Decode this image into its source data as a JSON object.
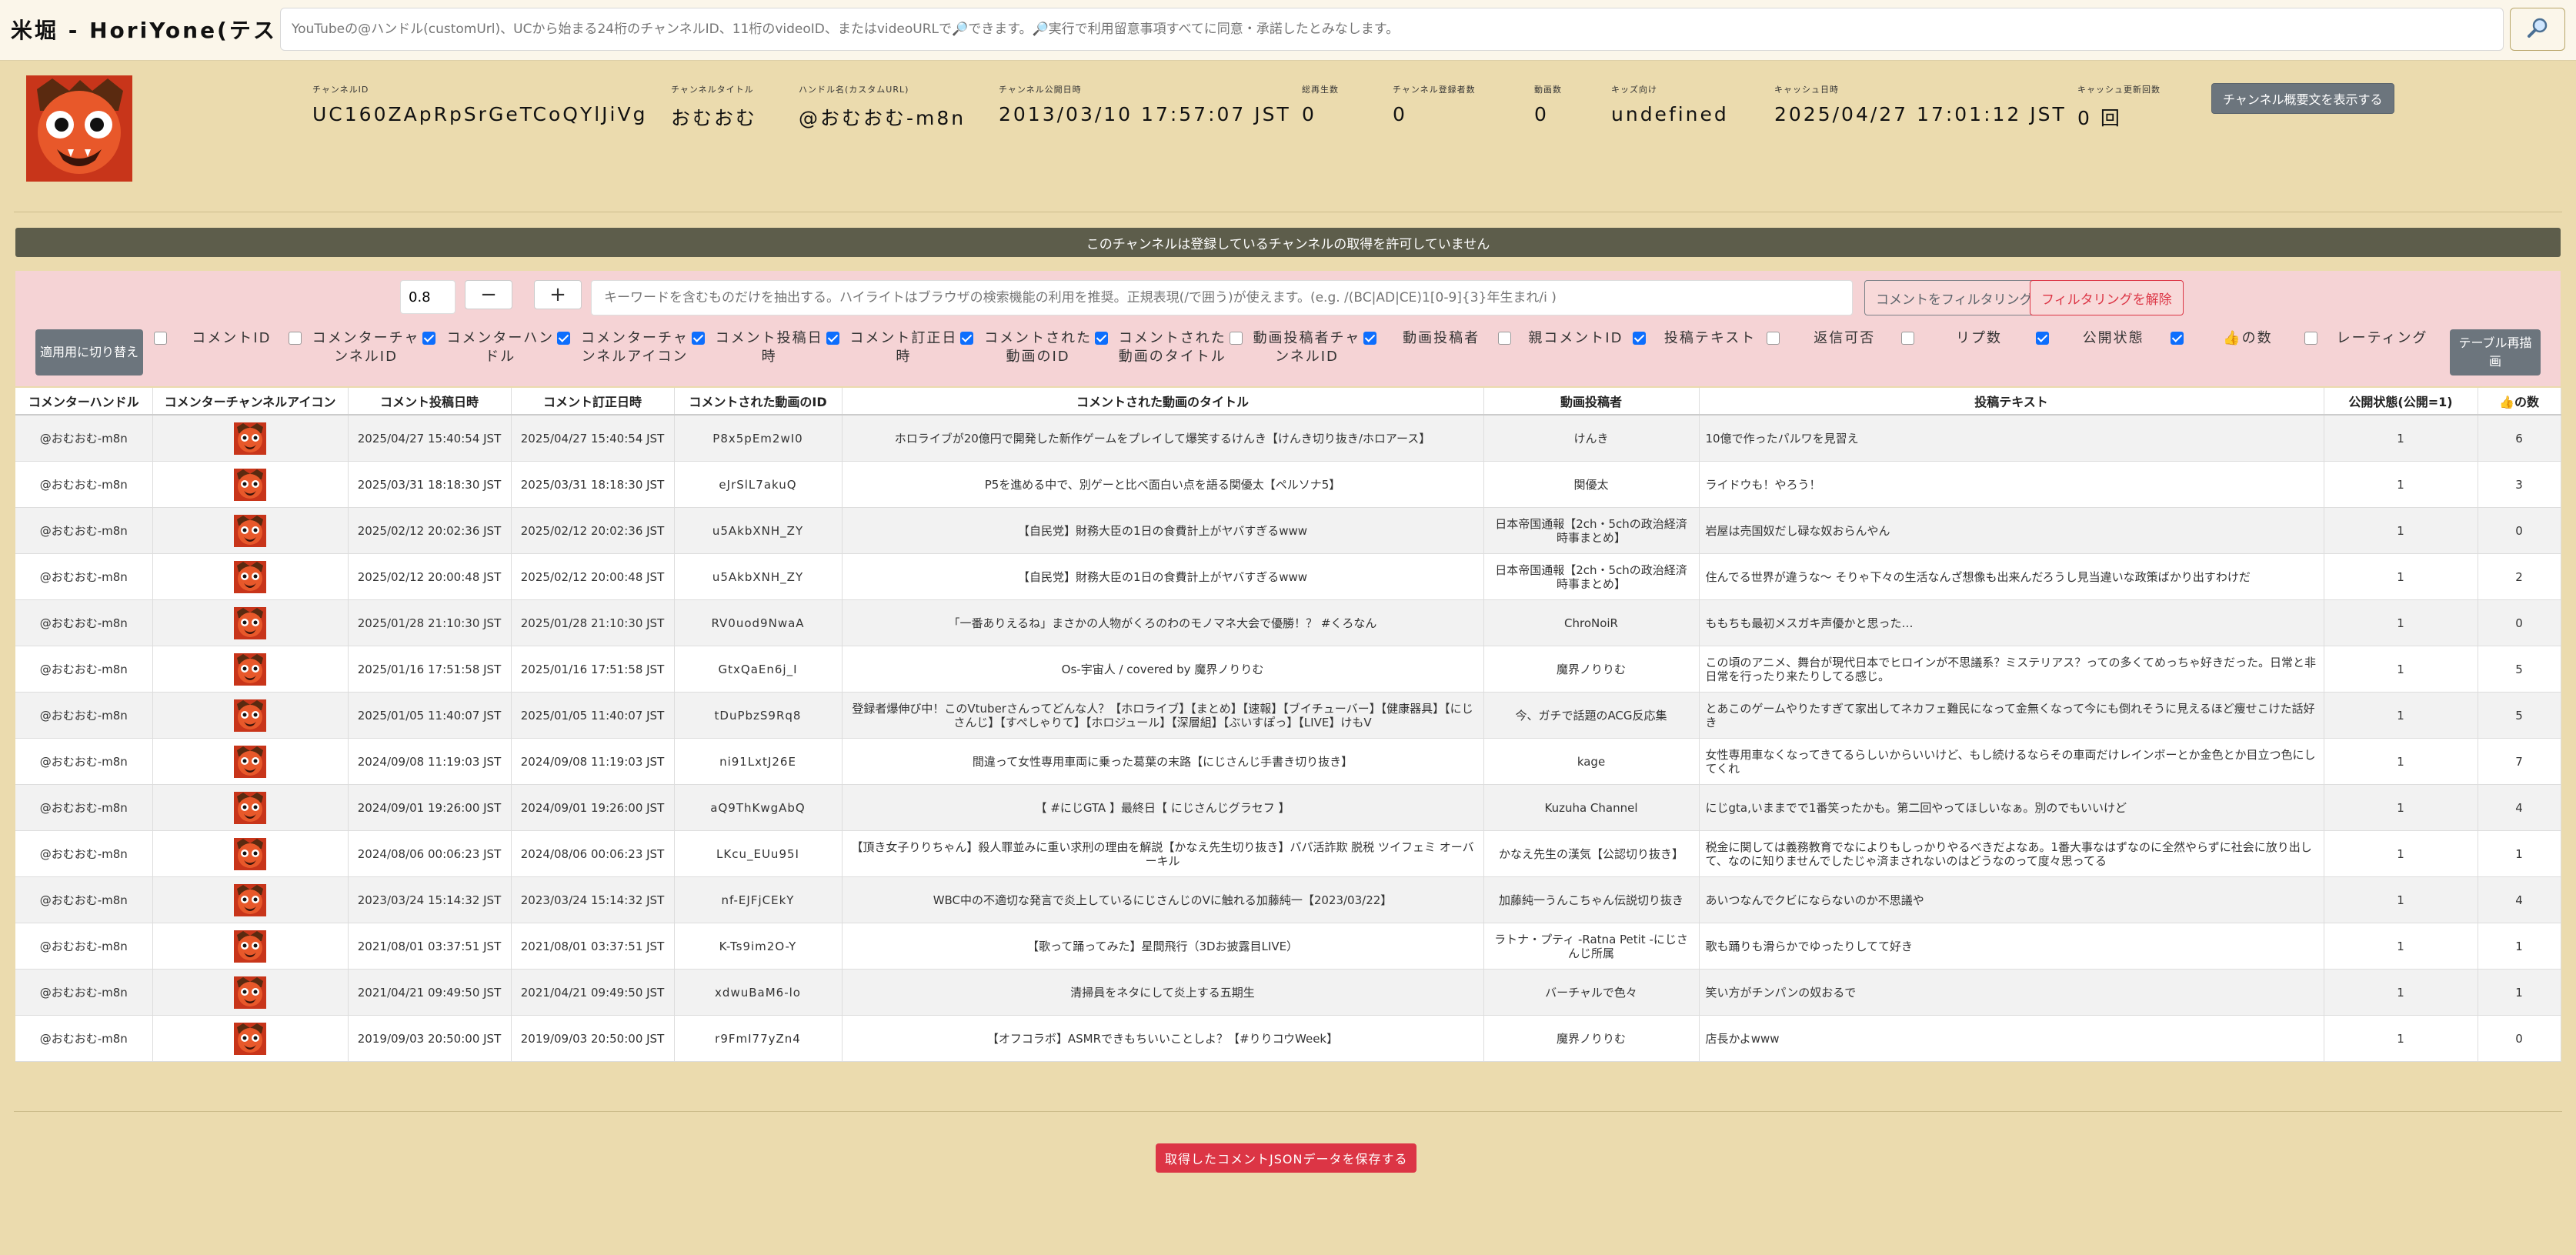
{
  "header": {
    "title": "米堀 - HoriYone(テスト中)",
    "search_placeholder": "YouTubeの@ハンドル(customUrl)、UCから始まる24桁のチャンネルID、11桁のvideoID、またはvideoURLで🔎できます。🔎実行で利用留意事項すべてに同意・承諾したとみなします。",
    "search_icon": "search-icon"
  },
  "channel": {
    "items": [
      {
        "label": "チャンネルID",
        "value": "UC160ZApRpSrGeTCoQYlJiVg"
      },
      {
        "label": "チャンネルタイトル",
        "value": "おむおむ"
      },
      {
        "label": "ハンドル名(カスタムURL)",
        "value": "@おむおむ-m8n"
      },
      {
        "label": "チャンネル公開日時",
        "value": "2013/03/10 17:57:07 JST"
      },
      {
        "label": "総再生数",
        "value": "0"
      },
      {
        "label": "チャンネル登録者数",
        "value": "0"
      },
      {
        "label": "動画数",
        "value": "0"
      },
      {
        "label": "キッズ向け",
        "value": "undefined"
      },
      {
        "label": "キャッシュ日時",
        "value": "2025/04/27 17:01:12 JST"
      },
      {
        "label": "キャッシュ更新回数",
        "value": "0 回"
      }
    ],
    "show_desc_label": "チャンネル概要文を表示する"
  },
  "notice": "このチャンネルは登録しているチャンネルの取得を許可していません",
  "filter": {
    "threshold": "0.8",
    "minus_label": "−",
    "plus_label": "+",
    "keyword_placeholder": "キーワードを含むものだけを抽出する。ハイライトはブラウザの検索機能の利用を推奨。正規表現(/で囲う)が使えます。(e.g. /(BC|AD|CE)1[0-9]{3}年生まれ/i )",
    "filter_label": "コメントをフィルタリング",
    "clear_label": "フィルタリングを解除",
    "apply_label": "適用用に切り替え",
    "redraw_label": "テーブル再描画"
  },
  "columns": [
    {
      "label": "コメントID",
      "checked": false
    },
    {
      "label": "コメンターチャンネルID",
      "checked": false
    },
    {
      "label": "コメンターハンドル",
      "checked": true
    },
    {
      "label": "コメンターチャンネルアイコン",
      "checked": true
    },
    {
      "label": "コメント投稿日時",
      "checked": true
    },
    {
      "label": "コメント訂正日時",
      "checked": true
    },
    {
      "label": "コメントされた動画のID",
      "checked": true
    },
    {
      "label": "コメントされた動画のタイトル",
      "checked": true
    },
    {
      "label": "動画投稿者チャンネルID",
      "checked": false
    },
    {
      "label": "動画投稿者",
      "checked": true
    },
    {
      "label": "親コメントID",
      "checked": false
    },
    {
      "label": "投稿テキスト",
      "checked": true
    },
    {
      "label": "返信可否",
      "checked": false
    },
    {
      "label": "リプ数",
      "checked": false
    },
    {
      "label": "公開状態",
      "checked": true
    },
    {
      "label": "👍の数",
      "checked": true
    },
    {
      "label": "レーティング",
      "checked": false
    }
  ],
  "table": {
    "headers": [
      "コメンターハンドル",
      "コメンターチャンネルアイコン",
      "コメント投稿日時",
      "コメント訂正日時",
      "コメントされた動画のID",
      "コメントされた動画のタイトル",
      "動画投稿者",
      "投稿テキスト",
      "公開状態(公開=1)",
      "👍の数"
    ],
    "rows": [
      [
        "@おむおむ-m8n",
        "",
        "2025/04/27 15:40:54 JST",
        "2025/04/27 15:40:54 JST",
        "P8x5pEm2wI0",
        "ホロライブが20億円で開発した新作ゲームをプレイして爆笑するけんき【けんき切り抜き/ホロアース】",
        "けんき",
        "10億で作ったパルワを見習え",
        "1",
        "6"
      ],
      [
        "@おむおむ-m8n",
        "",
        "2025/03/31 18:18:30 JST",
        "2025/03/31 18:18:30 JST",
        "eJrSlL7akuQ",
        "P5を進める中で、別ゲーと比べ面白い点を語る関優太【ペルソナ5】",
        "関優太",
        "ライドウも！やろう！",
        "1",
        "3"
      ],
      [
        "@おむおむ-m8n",
        "",
        "2025/02/12 20:02:36 JST",
        "2025/02/12 20:02:36 JST",
        "u5AkbXNH_ZY",
        "【自民党】財務大臣の1日の食費計上がヤバすぎるwww",
        "日本帝国通報【2ch・5chの政治経済時事まとめ】",
        "岩屋は売国奴だし碌な奴おらんやん",
        "1",
        "0"
      ],
      [
        "@おむおむ-m8n",
        "",
        "2025/02/12 20:00:48 JST",
        "2025/02/12 20:00:48 JST",
        "u5AkbXNH_ZY",
        "【自民党】財務大臣の1日の食費計上がヤバすぎるwww",
        "日本帝国通報【2ch・5chの政治経済時事まとめ】",
        "住んでる世界が違うな～ そりゃ下々の生活なんざ想像も出来んだろうし見当違いな政策ばかり出すわけだ",
        "1",
        "2"
      ],
      [
        "@おむおむ-m8n",
        "",
        "2025/01/28 21:10:30 JST",
        "2025/01/28 21:10:30 JST",
        "RV0uod9NwaA",
        "「一番ありえるね」まさかの人物がくろのわのモノマネ大会で優勝！？ #くろなん",
        "ChroNoiR",
        "ももちも最初メスガキ声優かと思った…",
        "1",
        "0"
      ],
      [
        "@おむおむ-m8n",
        "",
        "2025/01/16 17:51:58 JST",
        "2025/01/16 17:51:58 JST",
        "GtxQaEn6j_I",
        "Os-宇宙人 / covered by 魔界ノりりむ",
        "魔界ノりりむ",
        "この頃のアニメ、舞台が現代日本でヒロインが不思議系？ミステリアス？っての多くてめっちゃ好きだった。日常と非日常を行ったり来たりしてる感じ。",
        "1",
        "5"
      ],
      [
        "@おむおむ-m8n",
        "",
        "2025/01/05 11:40:07 JST",
        "2025/01/05 11:40:07 JST",
        "tDuPbzS9Rq8",
        "登録者爆伸び中！このVtuberさんってどんな人？【ホロライブ】【まとめ】【速報】【ブイチューバー】【健康器具】【にじさんじ】【すぺしゃりて】【ホロジュール】【深層組】【ぶいすぽっ】【LIVE】けもV",
        "今、ガチで話題のACG反応集",
        "とあこのゲームやりたすぎて家出してネカフェ難民になって金無くなって今にも倒れそうに見えるほど痩せこけた話好き",
        "1",
        "5"
      ],
      [
        "@おむおむ-m8n",
        "",
        "2024/09/08 11:19:03 JST",
        "2024/09/08 11:19:03 JST",
        "ni91LxtJ26E",
        "間違って女性専用車両に乗った葛葉の末路【にじさんじ手書き切り抜き】",
        "kage",
        "女性専用車なくなってきてるらしいからいいけど、もし続けるならその車両だけレインボーとか金色とか目立つ色にしてくれ",
        "1",
        "7"
      ],
      [
        "@おむおむ-m8n",
        "",
        "2024/09/01 19:26:00 JST",
        "2024/09/01 19:26:00 JST",
        "aQ9ThKwgAbQ",
        "【 #にじGTA 】最終日【 にじさんじグラセフ 】",
        "Kuzuha Channel",
        "にじgta,いままでで1番笑ったかも。第二回やってほしいなぁ。別のでもいいけど",
        "1",
        "4"
      ],
      [
        "@おむおむ-m8n",
        "",
        "2024/08/06 00:06:23 JST",
        "2024/08/06 00:06:23 JST",
        "LKcu_EUu95I",
        "【頂き女子りりちゃん】殺人罪並みに重い求刑の理由を解説【かなえ先生切り抜き】パパ活詐欺 脱税 ツイフェミ オーバーキル",
        "かなえ先生の漢気【公認切り抜き】",
        "税金に関しては義務教育でなによりもしっかりやるべきだよなあ。1番大事なはずなのに全然やらずに社会に放り出して、なのに知りませんでしたじゃ済まされないのはどうなのって度々思ってる",
        "1",
        "1"
      ],
      [
        "@おむおむ-m8n",
        "",
        "2023/03/24 15:14:32 JST",
        "2023/03/24 15:14:32 JST",
        "nf-EJFjCEkY",
        "WBC中の不適切な発言で炎上しているにじさんじのVに触れる加藤純一【2023/03/22】",
        "加藤純一うんこちゃん伝説切り抜き",
        "あいつなんでクビにならないのか不思議や",
        "1",
        "4"
      ],
      [
        "@おむおむ-m8n",
        "",
        "2021/08/01 03:37:51 JST",
        "2021/08/01 03:37:51 JST",
        "K-Ts9im2O-Y",
        "【歌って踊ってみた】星間飛行（3Dお披露目LIVE）",
        "ラトナ・プティ -Ratna Petit -にじさんじ所属",
        "歌も踊りも滑らかでゆったりしてて好き",
        "1",
        "1"
      ],
      [
        "@おむおむ-m8n",
        "",
        "2021/04/21 09:49:50 JST",
        "2021/04/21 09:49:50 JST",
        "xdwuBaM6-lo",
        "清掃員をネタにして炎上する五期生",
        "バーチャルで色々",
        "笑い方がチンパンの奴おるで",
        "1",
        "1"
      ],
      [
        "@おむおむ-m8n",
        "",
        "2019/09/03 20:50:00 JST",
        "2019/09/03 20:50:00 JST",
        "r9FmI77yZn4",
        "【オフコラボ】ASMRできもちいいことしよ？【#りりコウWeek】",
        "魔界ノりりむ",
        "店長かよwww",
        "1",
        "0"
      ]
    ]
  },
  "save_label": "取得したコメントJSONデータを保存する",
  "colors": {
    "page_bg": "#ebdbae",
    "banner_bg": "#5d5d4b",
    "filter_bg": "#f5d3d5",
    "checkbox": "#0d6efd",
    "danger": "#dc3545",
    "secondary": "#6c757d"
  }
}
